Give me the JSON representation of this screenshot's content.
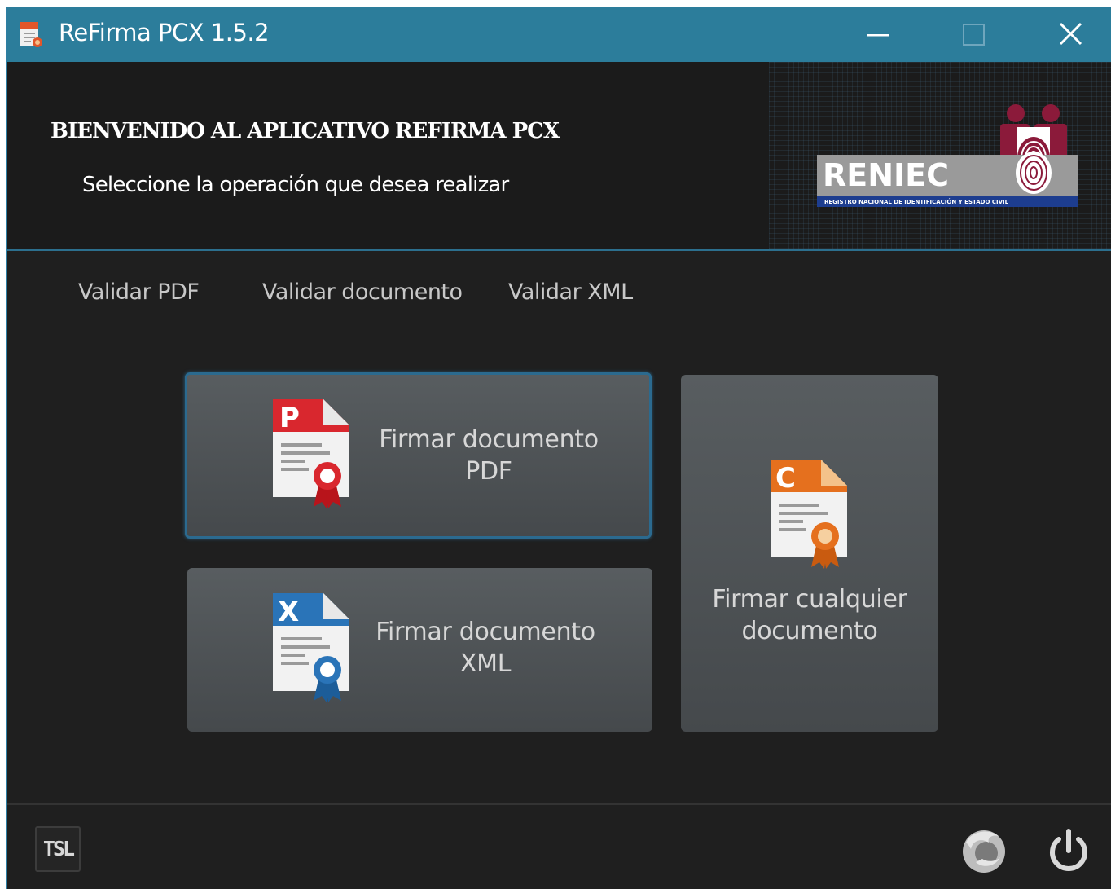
{
  "window": {
    "title": "ReFirma PCX 1.5.2",
    "icon": "refirma-app-icon",
    "controls": [
      "minimize-icon",
      "maximize-icon",
      "close-icon"
    ]
  },
  "header": {
    "welcome": "BIENVENIDO AL APLICATIVO REFIRMA PCX",
    "subtitle": "Seleccione la operación que desea realizar",
    "logo": {
      "name": "RENIEC",
      "tagline": "REGISTRO NACIONAL DE IDENTIFICACIÓN Y ESTADO CIVIL"
    }
  },
  "links": [
    {
      "label": "Validar PDF"
    },
    {
      "label": "Validar documento"
    },
    {
      "label": "Validar XML"
    }
  ],
  "actions": {
    "pdf": {
      "line1": "Firmar documento",
      "line2": "PDF",
      "icon": "pdf-certificate-icon",
      "badge": "P"
    },
    "xml": {
      "line1": "Firmar documento",
      "line2": "XML",
      "icon": "xml-certificate-icon",
      "badge": "X"
    },
    "any": {
      "line1": "Firmar cualquier",
      "line2": "documento",
      "icon": "document-certificate-icon",
      "badge": "C"
    }
  },
  "footer": {
    "tsl": "TSL",
    "icons": [
      "firefox-icon",
      "power-icon"
    ]
  },
  "colors": {
    "titlebar": "#2c7d9b",
    "background": "#1f1f1f",
    "header_border": "#2c6f8e",
    "pdf_red": "#d9272e",
    "xml_blue": "#2a74b8",
    "any_orange": "#e5701e",
    "reniec_maroon": "#8b1a3a"
  }
}
